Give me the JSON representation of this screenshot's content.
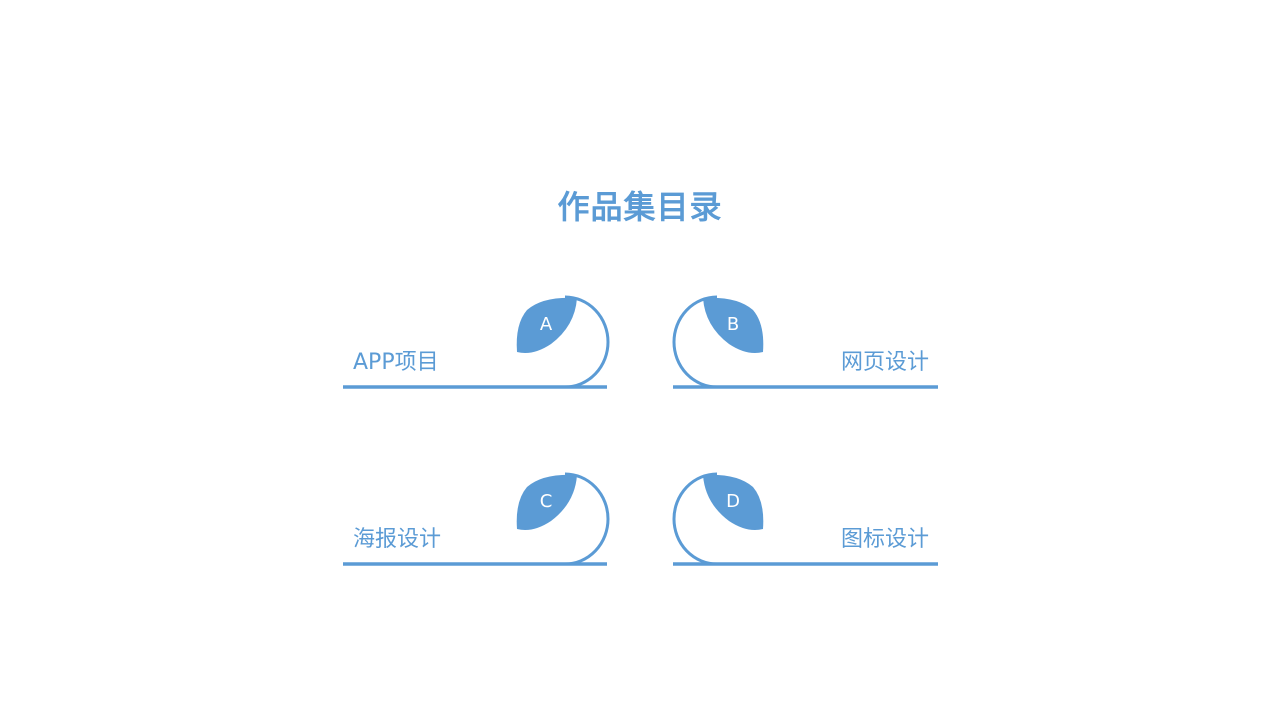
{
  "title": "作品集目录",
  "colors": {
    "accent": "#5b9bd5",
    "background": "#ffffff"
  },
  "items": [
    {
      "letter": "A",
      "label": "APP项目"
    },
    {
      "letter": "B",
      "label": "网页设计"
    },
    {
      "letter": "C",
      "label": "海报设计"
    },
    {
      "letter": "D",
      "label": "图标设计"
    }
  ]
}
